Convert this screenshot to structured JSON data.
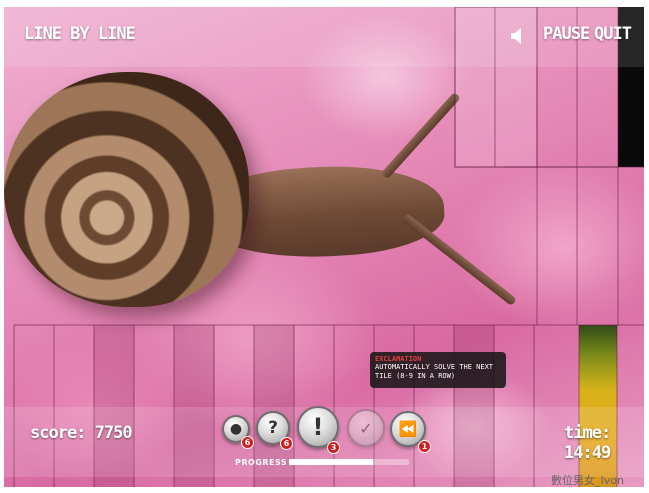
{
  "game": {
    "title": "LINE BY LINE",
    "pause_label": "PAUSE",
    "quit_label": "QUIT",
    "score_text": "score: 7750",
    "time_text": "time: 14:49"
  },
  "tools": {
    "hint_count": "6",
    "question_count": "6",
    "exclamation_count": "3",
    "rewind_count": "1"
  },
  "progress": {
    "label": "PROGRESS",
    "fraction": 0.7
  },
  "tooltip": {
    "title": "EXCLAMATION",
    "line1": "AUTOMATICALLY SOLVE THE NEXT",
    "line2": "TILE (8-9 IN A ROW)"
  },
  "watermark": "數位男女_Ivon",
  "colors": {
    "accent_badge": "#d11f1f",
    "tooltip_title": "#e04040"
  },
  "icons": [
    "speaker-icon",
    "lightbulb-icon",
    "question-icon",
    "exclamation-icon",
    "check-icon",
    "rewind-icon"
  ]
}
